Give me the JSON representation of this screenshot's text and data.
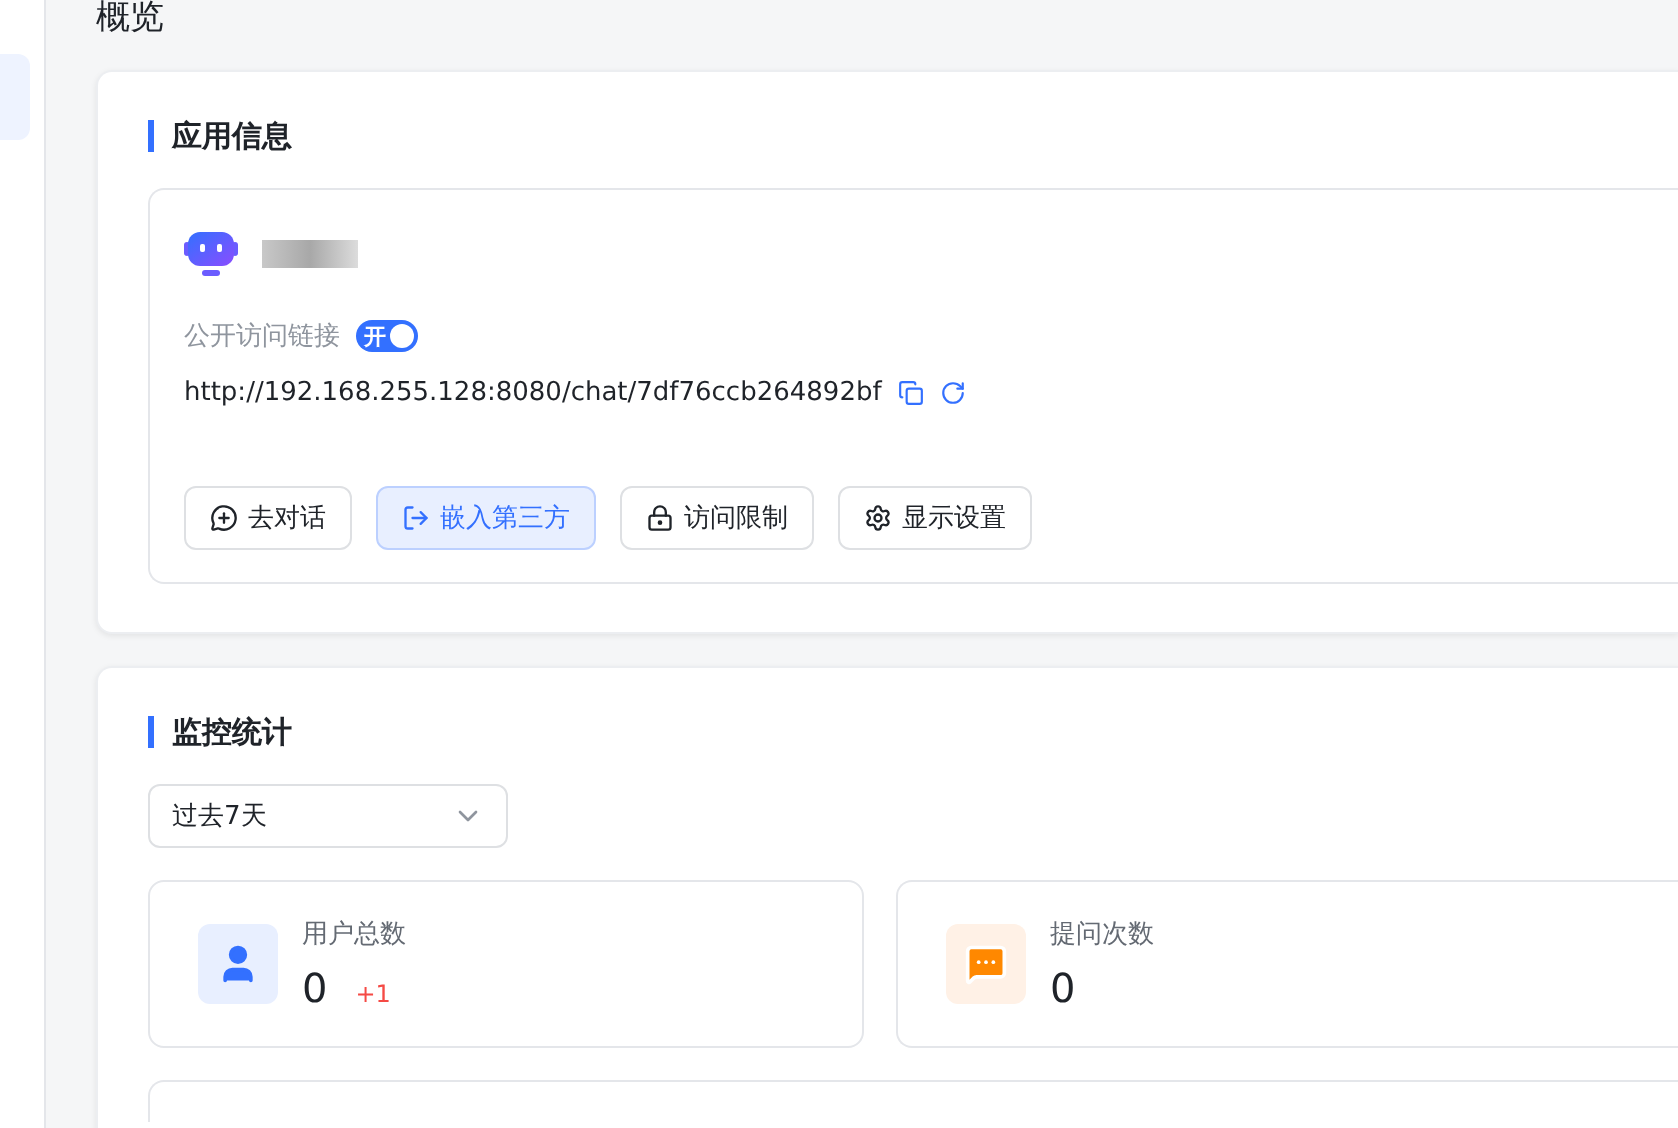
{
  "page_title": "概览",
  "app_info": {
    "title": "应用信息",
    "public_link": {
      "label": "公开访问链接",
      "toggle_label": "开",
      "on": true,
      "url": "http://192.168.255.128:8080/chat/7df76ccb264892bf"
    },
    "buttons": [
      {
        "label": "去对话",
        "kind": "chat",
        "selected": false
      },
      {
        "label": "嵌入第三方",
        "kind": "embed",
        "selected": true
      },
      {
        "label": "访问限制",
        "kind": "lock",
        "selected": false
      },
      {
        "label": "显示设置",
        "kind": "settings",
        "selected": false
      }
    ]
  },
  "monitor": {
    "title": "监控统计",
    "range": {
      "value": "过去7天"
    },
    "stats": [
      {
        "label": "用户总数",
        "value": "0",
        "delta": "+1",
        "kind": "user"
      },
      {
        "label": "提问次数",
        "value": "0",
        "kind": "question"
      }
    ]
  }
}
